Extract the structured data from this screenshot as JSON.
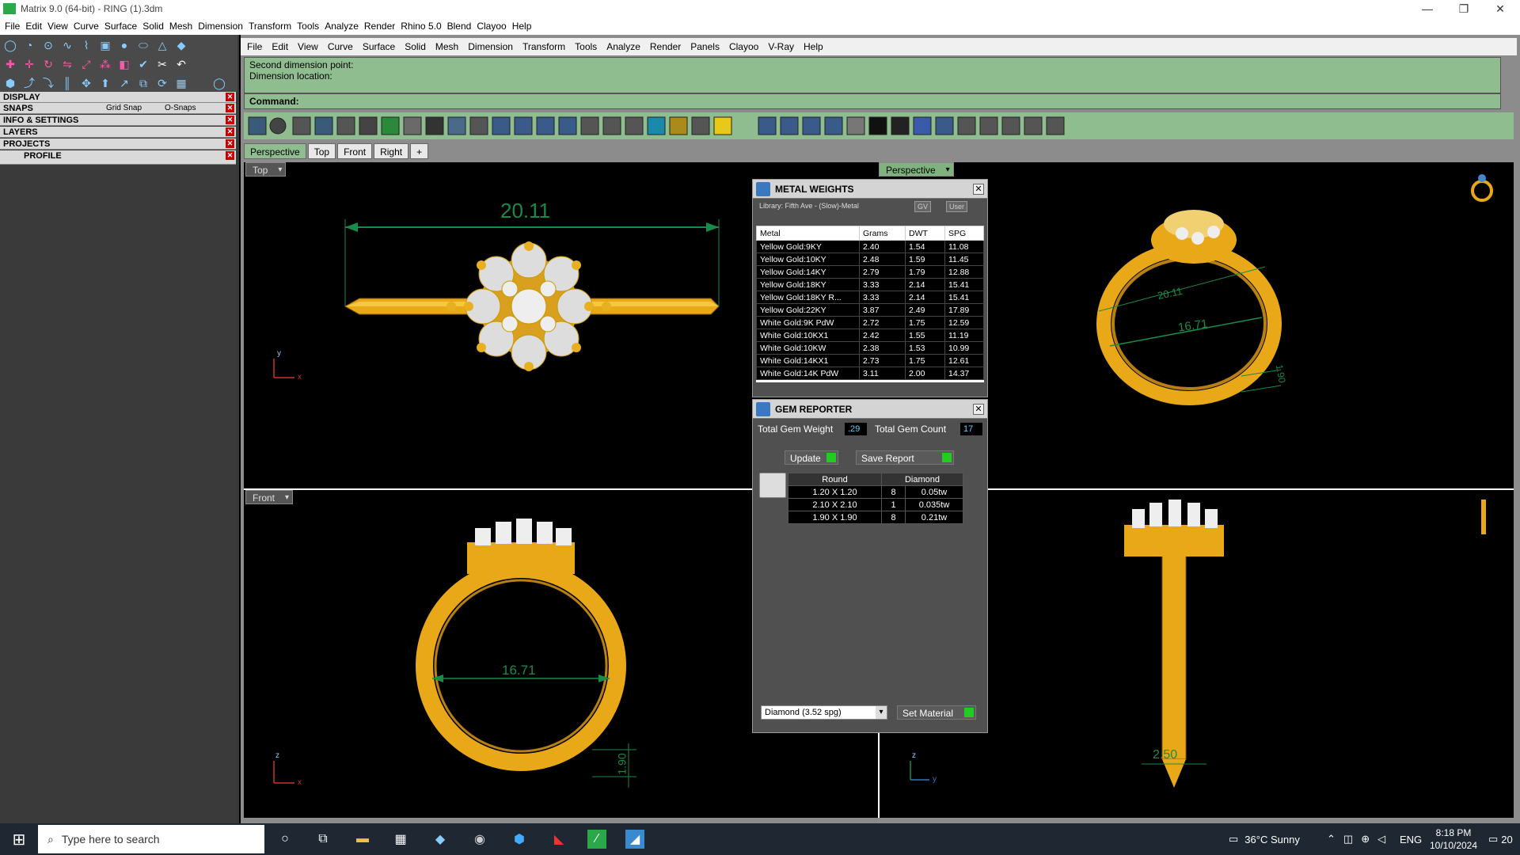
{
  "window": {
    "title": "Matrix 9.0 (64-bit) - RING (1).3dm",
    "minimize": "—",
    "restore": "❐",
    "close": "✕"
  },
  "menu1": [
    "File",
    "Edit",
    "View",
    "Curve",
    "Surface",
    "Solid",
    "Mesh",
    "Dimension",
    "Transform",
    "Tools",
    "Analyze",
    "Render",
    "Rhino 5.0",
    "Blend",
    "Clayoo",
    "Help"
  ],
  "menu2": [
    "File",
    "Edit",
    "View",
    "Curve",
    "Surface",
    "Solid",
    "Mesh",
    "Dimension",
    "Transform",
    "Tools",
    "Analyze",
    "Render",
    "Panels",
    "Clayoo",
    "V-Ray",
    "Help"
  ],
  "left_sections": {
    "display": "DISPLAY",
    "snaps": "SNAPS",
    "grid_snap": "Grid Snap",
    "osnaps": "O-Snaps",
    "info": "INFO & SETTINGS",
    "layers": "LAYERS",
    "projects": "PROJECTS",
    "profile": "PROFILE"
  },
  "command": {
    "line1": "Second dimension point:",
    "line2": "Dimension location:",
    "label": "Command:"
  },
  "viewport_tabs": [
    "Perspective",
    "Top",
    "Front",
    "Right",
    "+"
  ],
  "viewports": {
    "top": "Top",
    "perspective": "Perspective",
    "front": "Front"
  },
  "dims": {
    "top_width": "20.11",
    "persp_a": "20.11",
    "persp_b": "16.71",
    "persp_c": "1.90",
    "front_inner": "16.71",
    "front_band": "1.90",
    "side_width": "2.50"
  },
  "axes": {
    "y": "y",
    "x": "x",
    "z": "z"
  },
  "metal_weights": {
    "title": "METAL WEIGHTS",
    "library": "Library: Fifth Ave - (Slow)-Metal",
    "gv": "GV",
    "user": "User",
    "headers": [
      "Metal",
      "Grams",
      "DWT",
      "SPG"
    ],
    "rows": [
      [
        "Yellow Gold:9KY",
        "2.40",
        "1.54",
        "11.08"
      ],
      [
        "Yellow Gold:10KY",
        "2.48",
        "1.59",
        "11.45"
      ],
      [
        "Yellow Gold:14KY",
        "2.79",
        "1.79",
        "12.88"
      ],
      [
        "Yellow Gold:18KY",
        "3.33",
        "2.14",
        "15.41"
      ],
      [
        "Yellow Gold:18KY R...",
        "3.33",
        "2.14",
        "15.41"
      ],
      [
        "Yellow Gold:22KY",
        "3.87",
        "2.49",
        "17.89"
      ],
      [
        "White Gold:9K PdW",
        "2.72",
        "1.75",
        "12.59"
      ],
      [
        "White Gold:10KX1",
        "2.42",
        "1.55",
        "11.19"
      ],
      [
        "White Gold:10KW",
        "2.38",
        "1.53",
        "10.99"
      ],
      [
        "White Gold:14KX1",
        "2.73",
        "1.75",
        "12.61"
      ],
      [
        "White Gold:14K PdW",
        "3.11",
        "2.00",
        "14.37"
      ]
    ]
  },
  "gem_reporter": {
    "title": "GEM REPORTER",
    "total_weight_label": "Total Gem Weight",
    "total_weight": ".29",
    "total_count_label": "Total Gem Count",
    "total_count": "17",
    "update": "Update",
    "save_report": "Save Report",
    "headers": [
      "Round",
      "Diamond"
    ],
    "rows": [
      [
        "1.20 X 1.20",
        "8",
        "0.05tw"
      ],
      [
        "2.10 X 2.10",
        "1",
        "0.035tw"
      ],
      [
        "1.90 X 1.90",
        "8",
        "0.21tw"
      ]
    ],
    "material": "Diamond     (3.52 spg)",
    "set_material": "Set Material"
  },
  "taskbar": {
    "search_placeholder": "Type here to search",
    "weather": "36°C  Sunny",
    "lang": "ENG",
    "time": "8:18 PM",
    "date": "10/10/2024",
    "notif": "20"
  },
  "colors": {
    "gold": "#e8a818",
    "dim_green": "#1a8a4a",
    "cmd_green": "#8fbd8f"
  }
}
